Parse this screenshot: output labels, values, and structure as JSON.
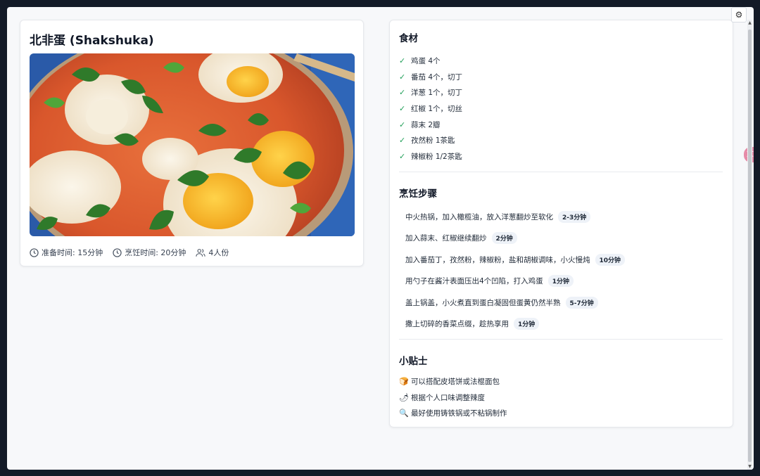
{
  "recipe": {
    "title": "北非蛋 (Shakshuka)",
    "meta": {
      "prep_time": "准备时间: 15分钟",
      "cook_time": "烹饪时间: 20分钟",
      "servings": "4人份"
    }
  },
  "ingredients": {
    "heading": "食材",
    "items": [
      "鸡蛋 4个",
      "番茄 4个，切丁",
      "洋葱 1个，切丁",
      "红椒 1个，切丝",
      "蒜末 2瓣",
      "孜然粉 1茶匙",
      "辣椒粉 1/2茶匙"
    ]
  },
  "steps": {
    "heading": "烹饪步骤",
    "items": [
      {
        "text": "中火热锅，加入橄榄油，放入洋葱翻炒至软化",
        "time": "2-3分钟"
      },
      {
        "text": "加入蒜末、红椒继续翻炒",
        "time": "2分钟"
      },
      {
        "text": "加入番茄丁，孜然粉，辣椒粉，盐和胡椒调味，小火慢炖",
        "time": "10分钟"
      },
      {
        "text": "用勺子在酱汁表面压出4个凹陷，打入鸡蛋",
        "time": "1分钟"
      },
      {
        "text": "盖上锅盖，小火煮直到蛋白凝固但蛋黄仍然半熟",
        "time": "5-7分钟"
      },
      {
        "text": "撒上切碎的香菜点缀，趁热享用",
        "time": "1分钟"
      }
    ]
  },
  "tips": {
    "heading": "小贴士",
    "items": [
      {
        "icon": "bread-icon",
        "glyph": "🍞",
        "text": "可以搭配皮塔饼或法棍面包"
      },
      {
        "icon": "chili-icon",
        "glyph": "🌶",
        "text": "根据个人口味调整辣度"
      },
      {
        "icon": "magnifier-icon",
        "glyph": "🔍",
        "text": "最好使用铸铁锅或不粘锅制作"
      }
    ]
  },
  "ui": {
    "settings_glyph": "⚙",
    "side_tab_glyph": "文",
    "check_glyph": "✓"
  },
  "colors": {
    "background": "#131a27",
    "page": "#f7f8fa",
    "check": "#22a05a",
    "badge_bg": "#eef2f8"
  }
}
